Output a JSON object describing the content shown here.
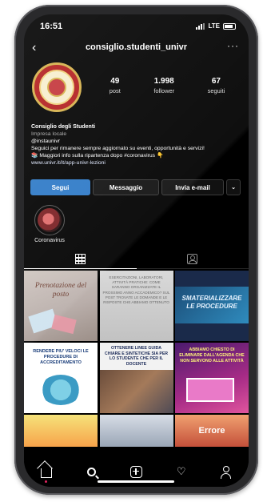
{
  "status_bar": {
    "time": "16:51",
    "network": "LTE"
  },
  "header": {
    "username": "consiglio.studenti_univr",
    "back_icon": "chevron-left-icon",
    "more_icon": "more-horizontal-icon"
  },
  "stats": [
    {
      "value": "49",
      "label": "post"
    },
    {
      "value": "1.998",
      "label": "follower"
    },
    {
      "value": "67",
      "label": "seguiti"
    }
  ],
  "bio": {
    "name": "Consiglio degli Studenti",
    "category": "Impresa locale",
    "handle": "@instaunivr",
    "line1": "Seguici per rimanere sempre aggiornato su eventi, opportunità e servizi!",
    "line2": "📚 Maggiori info sulla ripartenza dopo #coronavirus 👇",
    "link": "www.univr.it/it/app-univr-lezioni"
  },
  "buttons": {
    "follow": "Segui",
    "message": "Messaggio",
    "email": "Invia e-mail",
    "dropdown": "⌄"
  },
  "highlight": {
    "label": "Coronavirus"
  },
  "tabs": [
    {
      "name": "grid",
      "icon": "grid-icon"
    },
    {
      "name": "tagged",
      "icon": "tagged-person-icon"
    }
  ],
  "posts": [
    {
      "caption": "Prenotazione del posto"
    },
    {
      "caption": "ESERCITAZIONI, LABORATORI, ATTIVITÀ PRATICHE: COME SARANNO ORGANIZZATE IL PROSSIMO ANNO ACCADEMICO? SUL POST TROVATE LE DOMANDE E LE RISPOSTE CHE ABBIAMO OTTENUTO"
    },
    {
      "caption": "SMATERIALIZZARE LE PROCEDURE"
    },
    {
      "caption": "RENDERE PIU' VELOCI LE PROCEDURE DI ACCREDITAMENTO"
    },
    {
      "caption": "OTTENERE LINEE GUIDA CHIARE E SINTETICHE SIA PER LO STUDENTE CHE PER IL DOCENTE"
    },
    {
      "caption": "ABBIAMO CHIESTO DI ELIMINARE DALL'AGENDA CHE NON SERVONO ALLE ATTIVITÀ"
    },
    {
      "caption": ""
    },
    {
      "caption": ""
    },
    {
      "caption": "Errore"
    }
  ],
  "bottom_nav": [
    {
      "name": "home",
      "icon": "home-icon"
    },
    {
      "name": "search",
      "icon": "search-icon"
    },
    {
      "name": "new-post",
      "icon": "add-post-icon"
    },
    {
      "name": "activity",
      "icon": "heart-icon"
    },
    {
      "name": "profile",
      "icon": "profile-icon"
    }
  ],
  "colors": {
    "follow_button": "#2d79c7",
    "background": "#000000",
    "notification_dot": "#e0245e"
  }
}
